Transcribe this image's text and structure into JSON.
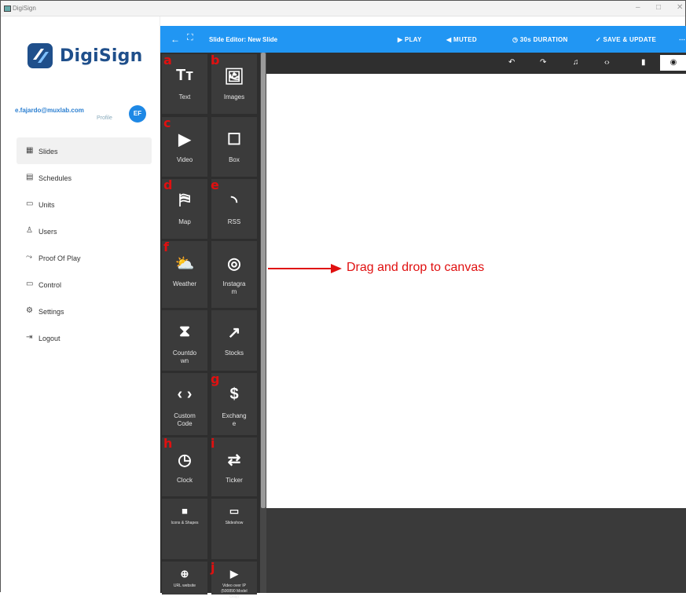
{
  "window": {
    "title": "DigiSign",
    "controls": [
      "–",
      "□",
      "✕"
    ]
  },
  "brand": {
    "name": "DigiSign",
    "colors": {
      "primary": "#2196f3",
      "dark_panel": "#2e2e2e",
      "tile": "#3b3b3b",
      "annotation": "#e01010"
    }
  },
  "user": {
    "email": "e.fajardo@muxlab.com",
    "profile_label": "Profile",
    "initials": "EF"
  },
  "sidebar": {
    "items": [
      {
        "label": "Slides",
        "icon": "grid-icon",
        "glyph": "▦",
        "active": true
      },
      {
        "label": "Schedules",
        "icon": "calendar-icon",
        "glyph": "▤",
        "active": false
      },
      {
        "label": "Units",
        "icon": "server-icon",
        "glyph": "▭",
        "active": false
      },
      {
        "label": "Users",
        "icon": "user-icon",
        "glyph": "♙",
        "active": false
      },
      {
        "label": "Proof Of Play",
        "icon": "trend-icon",
        "glyph": "⤳",
        "active": false
      },
      {
        "label": "Control",
        "icon": "monitor-icon",
        "glyph": "▭",
        "active": false
      },
      {
        "label": "Settings",
        "icon": "gear-icon",
        "glyph": "⚙",
        "active": false
      },
      {
        "label": "Logout",
        "icon": "logout-icon",
        "glyph": "⇥",
        "active": false
      }
    ]
  },
  "topbar": {
    "back": "←",
    "expand": "⛶",
    "title": "Slide Editor: New Slide",
    "actions": [
      {
        "label": "▶ PLAY",
        "icon": "play-icon"
      },
      {
        "label": "◀ MUTED",
        "icon": "mute-icon"
      },
      {
        "label": "◷ 30s DURATION",
        "icon": "clock-icon"
      },
      {
        "label": "✓ SAVE & UPDATE",
        "icon": "check-icon"
      },
      {
        "label": "⋯",
        "icon": "more-icon"
      }
    ]
  },
  "canvas_toolbar": {
    "buttons": [
      {
        "name": "undo",
        "glyph": "↶"
      },
      {
        "name": "redo",
        "glyph": "↷"
      },
      {
        "name": "music",
        "glyph": "♫"
      },
      {
        "name": "code",
        "glyph": "‹›"
      },
      {
        "name": "device",
        "glyph": "▮"
      },
      {
        "name": "preview",
        "glyph": "◉"
      }
    ]
  },
  "widgets": [
    {
      "label": "Text",
      "glyph": "Tт",
      "badge": "a",
      "icon": "text-icon"
    },
    {
      "label": "Images",
      "glyph": "🖼",
      "badge": "b",
      "icon": "image-icon"
    },
    {
      "label": "Video",
      "glyph": "▶",
      "badge": "c",
      "icon": "video-icon"
    },
    {
      "label": "Box",
      "glyph": "☐",
      "badge": "",
      "icon": "box-icon"
    },
    {
      "label": "Map",
      "glyph": "⛿",
      "badge": "d",
      "icon": "map-icon"
    },
    {
      "label": "RSS",
      "glyph": "◝",
      "badge": "e",
      "icon": "rss-icon"
    },
    {
      "label": "Weather",
      "glyph": "⛅",
      "badge": "f",
      "icon": "weather-icon"
    },
    {
      "label": "Instagram",
      "label_lines": [
        "Instagra",
        "m"
      ],
      "glyph": "◎",
      "badge": "",
      "icon": "instagram-icon"
    },
    {
      "label": "Countdown",
      "label_lines": [
        "Countdo",
        "wn"
      ],
      "glyph": "⧗",
      "badge": "",
      "icon": "hourglass-icon"
    },
    {
      "label": "Stocks",
      "glyph": "↗",
      "badge": "",
      "icon": "stocks-icon"
    },
    {
      "label": "Custom Code",
      "label_lines": [
        "Custom",
        "Code"
      ],
      "glyph": "‹ ›",
      "badge": "",
      "icon": "code-icon"
    },
    {
      "label": "Exchange",
      "label_lines": [
        "Exchang",
        "e"
      ],
      "glyph": "$",
      "badge": "g",
      "icon": "dollar-icon"
    },
    {
      "label": "Clock",
      "glyph": "◷",
      "badge": "h",
      "icon": "clock-icon"
    },
    {
      "label": "Ticker",
      "glyph": "⇄",
      "badge": "i",
      "icon": "ticker-icon"
    },
    {
      "label": "Icons & Shapes",
      "glyph": "■",
      "badge": "",
      "icon": "shapes-icon"
    },
    {
      "label": "Slideshow",
      "glyph": "▭",
      "badge": "",
      "icon": "slideshow-icon"
    },
    {
      "label": "URL website",
      "glyph": "⊕",
      "badge": "",
      "icon": "globe-icon"
    },
    {
      "label": "Video over IP (500890 Model Only)",
      "label_lines": [
        "Video over IP",
        "(500890 Model",
        "Only)"
      ],
      "glyph": "▶",
      "badge": "j",
      "icon": "video-ip-icon"
    }
  ],
  "annotation": {
    "text": "Drag and drop to canvas"
  }
}
